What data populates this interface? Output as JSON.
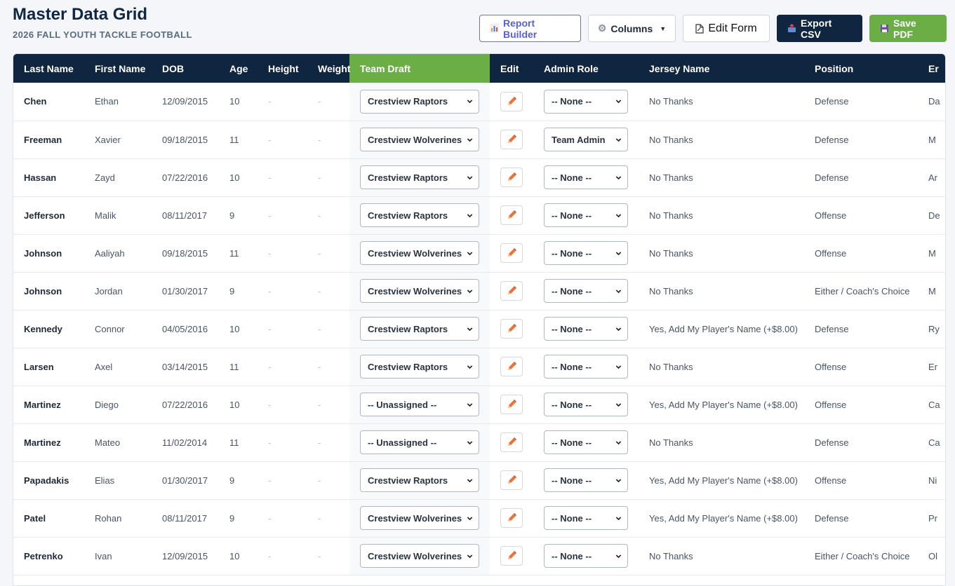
{
  "page": {
    "title": "Master Data Grid",
    "subtitle": "2026 FALL YOUTH TACKLE FOOTBALL"
  },
  "toolbar": {
    "report_builder": "Report Builder",
    "columns": "Columns",
    "edit_form": "Edit Form",
    "export_csv": "Export CSV",
    "save_pdf": "Save PDF"
  },
  "columns": {
    "last_name": "Last Name",
    "first_name": "First Name",
    "dob": "DOB",
    "age": "Age",
    "height": "Height",
    "weight": "Weight",
    "team_draft": "Team Draft",
    "edit": "Edit",
    "admin_role": "Admin Role",
    "jersey_name": "Jersey Name",
    "position": "Position",
    "next": "Er"
  },
  "rows": [
    {
      "last": "Chen",
      "first": "Ethan",
      "dob": "12/09/2015",
      "age": "10",
      "height": "-",
      "weight": "-",
      "team": "Crestview Raptors",
      "admin": "-- None --",
      "jersey": "No Thanks",
      "position": "Defense",
      "next": "Da"
    },
    {
      "last": "Freeman",
      "first": "Xavier",
      "dob": "09/18/2015",
      "age": "11",
      "height": "-",
      "weight": "-",
      "team": "Crestview Wolverines",
      "admin": "Team Admin",
      "jersey": "No Thanks",
      "position": "Defense",
      "next": "M"
    },
    {
      "last": "Hassan",
      "first": "Zayd",
      "dob": "07/22/2016",
      "age": "10",
      "height": "-",
      "weight": "-",
      "team": "Crestview Raptors",
      "admin": "-- None --",
      "jersey": "No Thanks",
      "position": "Defense",
      "next": "Ar"
    },
    {
      "last": "Jefferson",
      "first": "Malik",
      "dob": "08/11/2017",
      "age": "9",
      "height": "-",
      "weight": "-",
      "team": "Crestview Raptors",
      "admin": "-- None --",
      "jersey": "No Thanks",
      "position": "Offense",
      "next": "De"
    },
    {
      "last": "Johnson",
      "first": "Aaliyah",
      "dob": "09/18/2015",
      "age": "11",
      "height": "-",
      "weight": "-",
      "team": "Crestview Wolverines",
      "admin": "-- None --",
      "jersey": "No Thanks",
      "position": "Offense",
      "next": "M"
    },
    {
      "last": "Johnson",
      "first": "Jordan",
      "dob": "01/30/2017",
      "age": "9",
      "height": "-",
      "weight": "-",
      "team": "Crestview Wolverines",
      "admin": "-- None --",
      "jersey": "No Thanks",
      "position": "Either / Coach's Choice",
      "next": "M"
    },
    {
      "last": "Kennedy",
      "first": "Connor",
      "dob": "04/05/2016",
      "age": "10",
      "height": "-",
      "weight": "-",
      "team": "Crestview Raptors",
      "admin": "-- None --",
      "jersey": "Yes, Add My Player's Name (+$8.00)",
      "position": "Defense",
      "next": "Ry"
    },
    {
      "last": "Larsen",
      "first": "Axel",
      "dob": "03/14/2015",
      "age": "11",
      "height": "-",
      "weight": "-",
      "team": "Crestview Raptors",
      "admin": "-- None --",
      "jersey": "No Thanks",
      "position": "Offense",
      "next": "Er"
    },
    {
      "last": "Martinez",
      "first": "Diego",
      "dob": "07/22/2016",
      "age": "10",
      "height": "-",
      "weight": "-",
      "team": "-- Unassigned --",
      "admin": "-- None --",
      "jersey": "Yes, Add My Player's Name (+$8.00)",
      "position": "Offense",
      "next": "Ca"
    },
    {
      "last": "Martinez",
      "first": "Mateo",
      "dob": "11/02/2014",
      "age": "11",
      "height": "-",
      "weight": "-",
      "team": "-- Unassigned --",
      "admin": "-- None --",
      "jersey": "No Thanks",
      "position": "Defense",
      "next": "Ca"
    },
    {
      "last": "Papadakis",
      "first": "Elias",
      "dob": "01/30/2017",
      "age": "9",
      "height": "-",
      "weight": "-",
      "team": "Crestview Raptors",
      "admin": "-- None --",
      "jersey": "Yes, Add My Player's Name (+$8.00)",
      "position": "Offense",
      "next": "Ni"
    },
    {
      "last": "Patel",
      "first": "Rohan",
      "dob": "08/11/2017",
      "age": "9",
      "height": "-",
      "weight": "-",
      "team": "Crestview Wolverines",
      "admin": "-- None --",
      "jersey": "Yes, Add My Player's Name (+$8.00)",
      "position": "Defense",
      "next": "Pr"
    },
    {
      "last": "Petrenko",
      "first": "Ivan",
      "dob": "12/09/2015",
      "age": "10",
      "height": "-",
      "weight": "-",
      "team": "Crestview Wolverines",
      "admin": "-- None --",
      "jersey": "No Thanks",
      "position": "Either / Coach's Choice",
      "next": "Ol"
    }
  ],
  "colors": {
    "header_bg": "#10253f",
    "draft_header_bg": "#6aae45",
    "pencil": "#e8743b",
    "report_accent": "#5b5fd0"
  }
}
